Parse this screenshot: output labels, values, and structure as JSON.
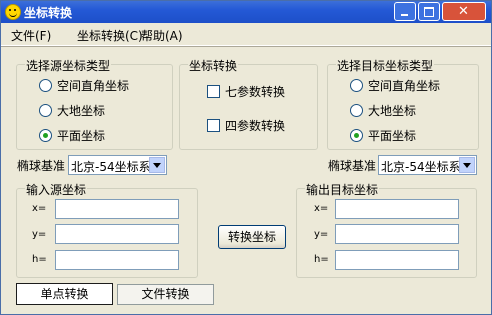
{
  "window": {
    "title": "坐标转换"
  },
  "menu": [
    "文件(F)",
    "坐标转换(C)",
    "帮助(A)"
  ],
  "source_type": {
    "title": "选择源坐标类型",
    "options": [
      "空间直角坐标",
      "大地坐标",
      "平面坐标"
    ],
    "selected": "平面坐标"
  },
  "transform": {
    "title": "坐标转换",
    "options": [
      "七参数转换",
      "四参数转换"
    ]
  },
  "target_type": {
    "title": "选择目标坐标类型",
    "options": [
      "空间直角坐标",
      "大地坐标",
      "平面坐标"
    ],
    "selected": "平面坐标"
  },
  "ellipsoid_left": {
    "label": "椭球基准",
    "value": "北京-54坐标系"
  },
  "ellipsoid_right": {
    "label": "椭球基准",
    "value": "北京-54坐标系"
  },
  "input": {
    "title": "输入源坐标",
    "labels": [
      "x=",
      "y=",
      "h="
    ],
    "values": [
      "",
      "",
      ""
    ]
  },
  "output": {
    "title": "输出目标坐标",
    "labels": [
      "x=",
      "y=",
      "h="
    ],
    "values": [
      "",
      "",
      ""
    ]
  },
  "convert_button": "转换坐标",
  "tabs": [
    "单点转换",
    "文件转换"
  ]
}
